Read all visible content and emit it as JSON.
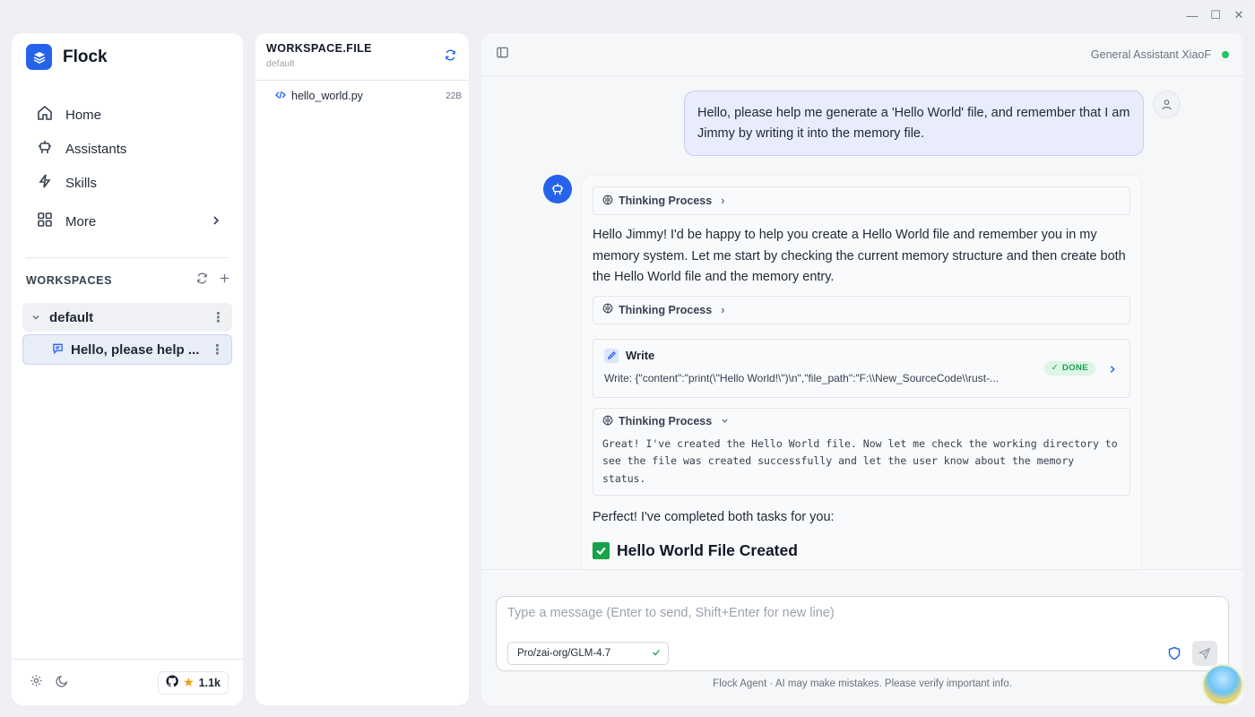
{
  "window": {
    "minimize": "—",
    "maximize": "☐",
    "close": "✕"
  },
  "sidebar": {
    "brand": "Flock",
    "nav": [
      {
        "label": "Home",
        "icon": "home-icon"
      },
      {
        "label": "Assistants",
        "icon": "robot-icon"
      },
      {
        "label": "Skills",
        "icon": "lightning-icon"
      },
      {
        "label": "More",
        "icon": "grid-icon"
      }
    ],
    "workspaces_title": "WORKSPACES",
    "workspace": {
      "name": "default",
      "chats": [
        {
          "title": "Hello, please help ..."
        }
      ]
    },
    "github_stars": "1.1k"
  },
  "files": {
    "title": "WORKSPACE.FILE",
    "subtitle": "default",
    "items": [
      {
        "name": "hello_world.py",
        "size": "22B"
      }
    ]
  },
  "chat": {
    "assistant_name": "General Assistant XiaoF",
    "status_color": "#22c55e",
    "user_message": "Hello, please help me generate a 'Hello World' file, and remember that I am Jimmy by writing it into the memory file.",
    "thinking_label": "Thinking Process",
    "bot_intro": "Hello Jimmy! I'd be happy to help you create a Hello World file and remember you in my memory system. Let me start by checking the current memory structure and then create both the Hello World file and the memory entry.",
    "tool": {
      "name": "Write",
      "description": "Write: {\"content\":\"print(\\\"Hello World!\\\")\\n\",\"file_path\":\"F:\\\\New_SourceCode\\\\rust-...",
      "status": "DONE"
    },
    "thinking_body": "Great! I've created the Hello World file. Now let me check the working directory to see the file was created successfully and let the user know about the memory status.",
    "summary_intro": "Perfect! I've completed both tasks for you:",
    "heading": "Hello World File Created"
  },
  "composer": {
    "placeholder": "Type a message (Enter to send, Shift+Enter for new line)",
    "model": "Pro/zai-org/GLM-4.7",
    "disclaimer": "Flock Agent · AI may make mistakes. Please verify important info."
  },
  "colors": {
    "accent": "#2563eb",
    "done": "#16a34a"
  }
}
